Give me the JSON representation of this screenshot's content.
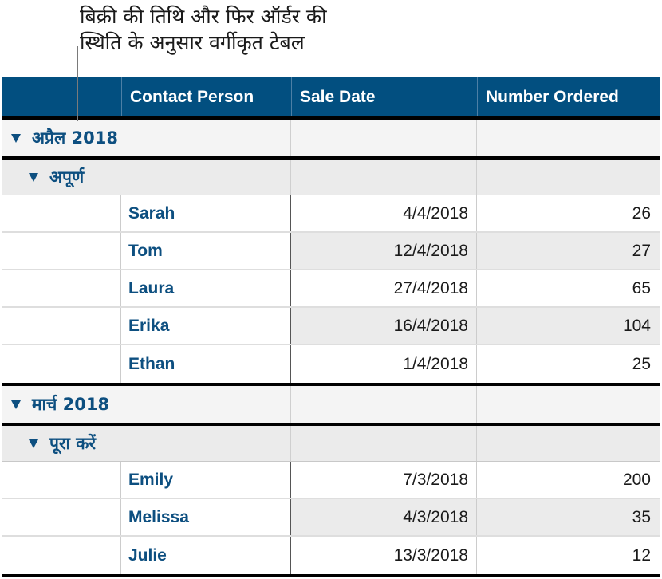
{
  "callout": {
    "lines": [
      "बिक्री की तिथि और फिर ऑर्डर की",
      "स्थिति के अनुसार वर्गीकृत टेबल"
    ]
  },
  "table": {
    "headers": [
      "",
      "Contact Person",
      "Sale Date",
      "Number Ordered"
    ],
    "colors": {
      "header_bg": "#024f80",
      "header_text": "#ffffff",
      "link_text": "#0d4f80",
      "group_bg": "#f4f4f4",
      "subgroup_bg": "#ebebeb",
      "alt_row_bg": "#ebebeb"
    },
    "groups": [
      {
        "label": "अप्रैल 2018",
        "icon": "disclosure-triangle-down",
        "subgroups": [
          {
            "label": "अपूर्ण",
            "icon": "disclosure-triangle-down",
            "rows": [
              {
                "contact": "Sarah",
                "date": "4/4/2018",
                "ordered": "26"
              },
              {
                "contact": "Tom",
                "date": "12/4/2018",
                "ordered": "27"
              },
              {
                "contact": "Laura",
                "date": "27/4/2018",
                "ordered": "65"
              },
              {
                "contact": "Erika",
                "date": "16/4/2018",
                "ordered": "104"
              },
              {
                "contact": "Ethan",
                "date": "1/4/2018",
                "ordered": "25"
              }
            ]
          }
        ]
      },
      {
        "label": "मार्च 2018",
        "icon": "disclosure-triangle-down",
        "subgroups": [
          {
            "label": "पूरा करें",
            "icon": "disclosure-triangle-down",
            "rows": [
              {
                "contact": "Emily",
                "date": "7/3/2018",
                "ordered": "200"
              },
              {
                "contact": "Melissa",
                "date": "4/3/2018",
                "ordered": "35"
              },
              {
                "contact": "Julie",
                "date": "13/3/2018",
                "ordered": "12"
              }
            ]
          }
        ]
      }
    ]
  }
}
